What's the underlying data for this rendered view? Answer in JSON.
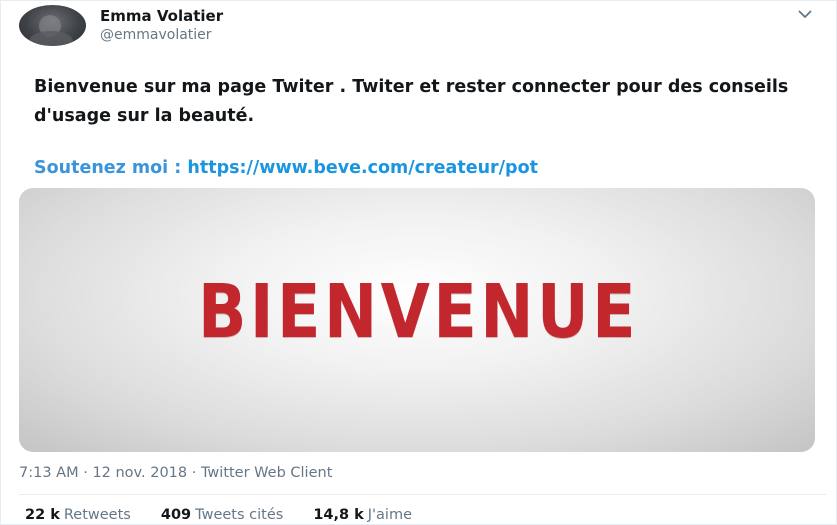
{
  "header": {
    "display_name": "Emma Volatier",
    "handle": "@emmavolatier",
    "avatar_icon": "avatar-icon",
    "menu_icon": "chevron-down-icon"
  },
  "tweet": {
    "text": "Bienvenue sur ma page Twiter . Twiter et rester connecter pour des conseils d'usage sur la beauté.",
    "support_label": "Soutenez moi : ",
    "support_url": "https://www.beve.com/createur/pot",
    "media_text": "BIENVENUE"
  },
  "meta": {
    "time": "7:13 AM",
    "separator1": " · ",
    "date": "12 nov. 2018",
    "separator2": " · ",
    "client": "Twitter Web Client"
  },
  "stats": {
    "retweets_count": "22 k",
    "retweets_label": "Retweets",
    "quotes_count": "409",
    "quotes_label": "Tweets cités",
    "likes_count": "14,8 k",
    "likes_label": "J'aime"
  },
  "colors": {
    "link": "#1b95e0",
    "muted": "#657786",
    "text": "#14171a",
    "media_word": "#c1272d"
  }
}
